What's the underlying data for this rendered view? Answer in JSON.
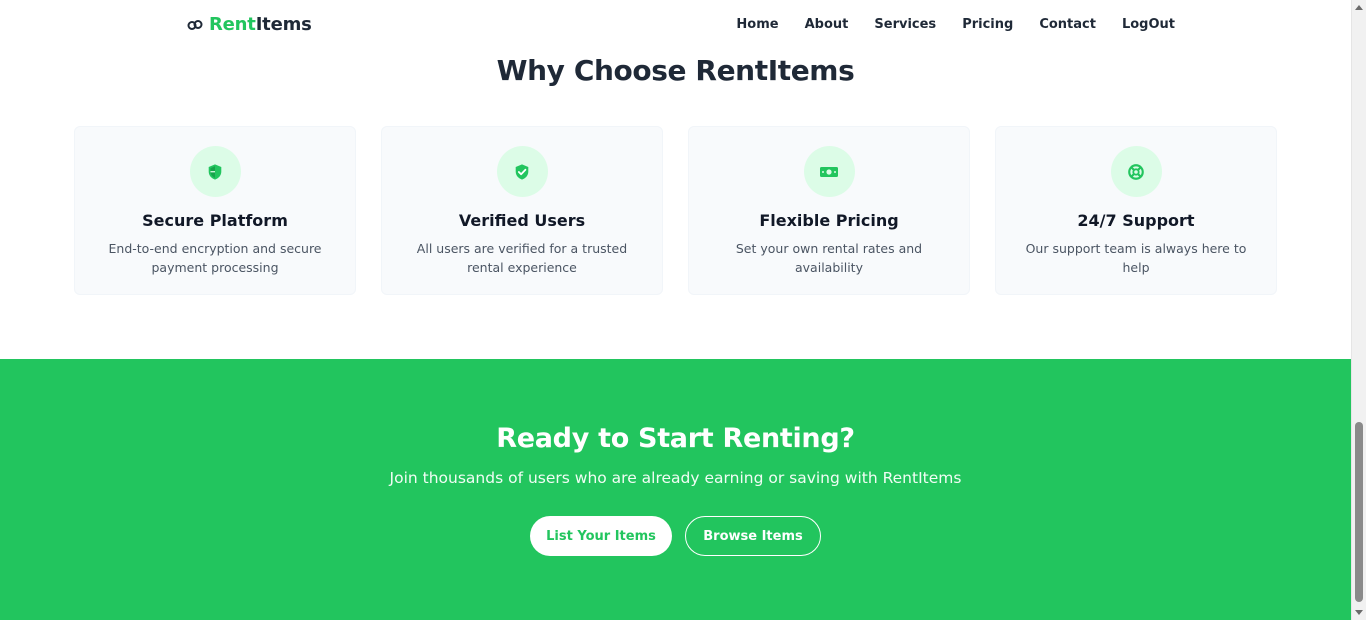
{
  "header": {
    "logo_rent": "Rent",
    "logo_items": "Items",
    "nav": [
      "Home",
      "About",
      "Services",
      "Pricing",
      "Contact",
      "LogOut"
    ]
  },
  "why": {
    "title": "Why Choose RentItems",
    "cards": [
      {
        "icon": "shield-icon",
        "title": "Secure Platform",
        "desc": "End-to-end encryption and secure payment processing"
      },
      {
        "icon": "check-badge-icon",
        "title": "Verified Users",
        "desc": "All users are verified for a trusted rental experience"
      },
      {
        "icon": "money-icon",
        "title": "Flexible Pricing",
        "desc": "Set your own rental rates and availability"
      },
      {
        "icon": "lifebuoy-icon",
        "title": "24/7 Support",
        "desc": "Our support team is always here to help"
      }
    ]
  },
  "cta": {
    "title": "Ready to Start Renting?",
    "subtitle": "Join thousands of users who are already earning or saving with RentItems",
    "primary_label": "List Your Items",
    "secondary_label": "Browse Items"
  },
  "colors": {
    "brand_green": "#22c55e",
    "icon_bg": "#dcfce7",
    "card_bg": "#f8fafc"
  }
}
